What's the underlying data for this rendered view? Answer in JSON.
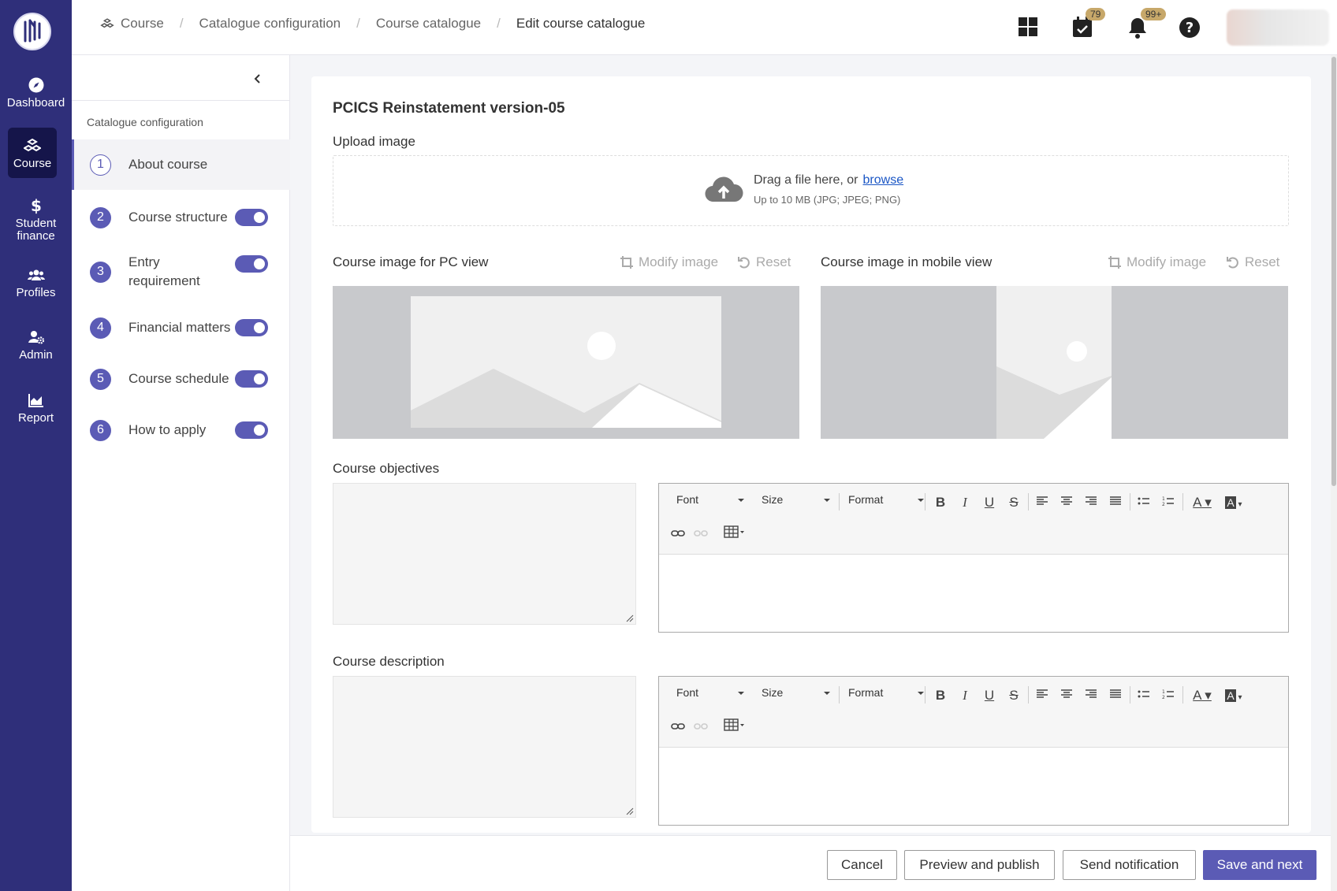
{
  "nav": {
    "items": [
      {
        "label": "Dashboard",
        "icon": "compass-icon"
      },
      {
        "label": "Course",
        "icon": "course-icon"
      },
      {
        "label": "Student finance",
        "icon": "dollar-icon"
      },
      {
        "label": "Profiles",
        "icon": "people-icon"
      },
      {
        "label": "Admin",
        "icon": "admin-gear-icon"
      },
      {
        "label": "Report",
        "icon": "chart-icon"
      }
    ]
  },
  "header": {
    "breadcrumbs": [
      "Course",
      "Catalogue configuration",
      "Course catalogue",
      "Edit course catalogue"
    ],
    "tasks_badge": "79",
    "notifications_badge": "99+"
  },
  "side": {
    "title": "Catalogue configuration",
    "steps": [
      {
        "num": "1",
        "label": "About course"
      },
      {
        "num": "2",
        "label": "Course structure"
      },
      {
        "num": "3",
        "label": "Entry requirement"
      },
      {
        "num": "4",
        "label": "Financial matters"
      },
      {
        "num": "5",
        "label": "Course schedule"
      },
      {
        "num": "6",
        "label": "How to apply"
      }
    ]
  },
  "main": {
    "title": "PCICS Reinstatement version-05",
    "upload": {
      "label": "Upload image",
      "drag_text": "Drag a file here, or",
      "browse": "browse",
      "hint": "Up to 10 MB (JPG; JPEG; PNG)"
    },
    "pc_image": {
      "label": "Course image for PC view",
      "modify": "Modify image",
      "reset": "Reset"
    },
    "mobile_image": {
      "label": "Course image in mobile view",
      "modify": "Modify image",
      "reset": "Reset"
    },
    "objectives": {
      "label": "Course objectives"
    },
    "description": {
      "label": "Course description"
    },
    "editor": {
      "font": "Font",
      "size": "Size",
      "format": "Format"
    }
  },
  "footer": {
    "cancel": "Cancel",
    "preview": "Preview and publish",
    "notify": "Send notification",
    "save": "Save and next"
  },
  "colors": {
    "nav_bg": "#2f2f7a",
    "accent": "#5b5bb5",
    "badge": "#c7a86a",
    "link": "#1a56c5"
  }
}
